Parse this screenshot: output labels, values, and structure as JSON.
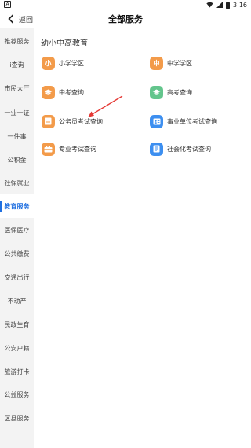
{
  "status_bar": {
    "left_glyph": "A",
    "time": "3:16"
  },
  "header": {
    "back_label": "返回",
    "title": "全部服务"
  },
  "sidebar": {
    "items": [
      {
        "label": "推荐服务",
        "active": false
      },
      {
        "label": "i查询",
        "active": false
      },
      {
        "label": "市民大厅",
        "active": false
      },
      {
        "label": "一业一证",
        "active": false
      },
      {
        "label": "一件事",
        "active": false
      },
      {
        "label": "公积金",
        "active": false
      },
      {
        "label": "社保就业",
        "active": false
      },
      {
        "label": "教育服务",
        "active": true
      },
      {
        "label": "医保医疗",
        "active": false
      },
      {
        "label": "公共缴费",
        "active": false
      },
      {
        "label": "交通出行",
        "active": false
      },
      {
        "label": "不动产",
        "active": false
      },
      {
        "label": "民政生育",
        "active": false
      },
      {
        "label": "公安户籍",
        "active": false
      },
      {
        "label": "旅游打卡",
        "active": false
      },
      {
        "label": "公益服务",
        "active": false
      },
      {
        "label": "区县服务",
        "active": false
      }
    ]
  },
  "section": {
    "title": "幼小中高教育",
    "services": [
      {
        "label": "小学学区",
        "icon_text": "小",
        "icon": "primary-school-icon",
        "color": "#f39b4a"
      },
      {
        "label": "中学学区",
        "icon_text": "中",
        "icon": "middle-school-icon",
        "color": "#f39b4a"
      },
      {
        "label": "中考查询",
        "icon_text": "",
        "icon": "graduation-cap-icon",
        "color": "#f39b4a"
      },
      {
        "label": "高考查询",
        "icon_text": "",
        "icon": "graduation-cap-icon",
        "color": "#63c58c"
      },
      {
        "label": "公务员考试查询",
        "icon_text": "",
        "icon": "document-icon",
        "color": "#f39b4a"
      },
      {
        "label": "事业单位考试查询",
        "icon_text": "",
        "icon": "id-card-icon",
        "color": "#3d8ff0"
      },
      {
        "label": "专业考试查询",
        "icon_text": "",
        "icon": "briefcase-icon",
        "color": "#f39b4a"
      },
      {
        "label": "社会化考试查询",
        "icon_text": "",
        "icon": "exam-sheet-icon",
        "color": "#3d8ff0"
      }
    ]
  },
  "annotation": {
    "arrow_color": "#e53935"
  }
}
